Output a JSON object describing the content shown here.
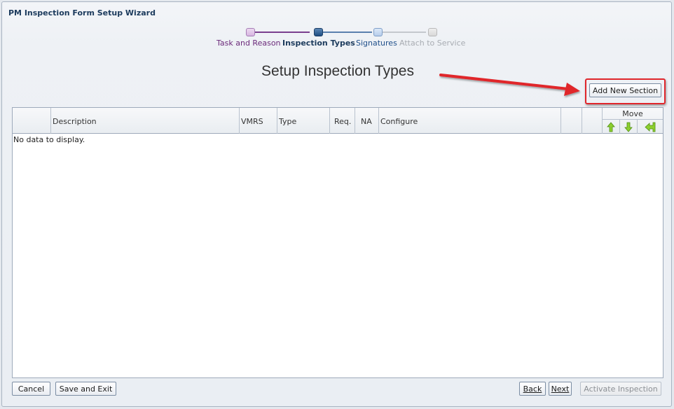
{
  "wizard": {
    "title": "PM Inspection Form Setup Wizard"
  },
  "train": {
    "steps": [
      {
        "label": "Task and Reason",
        "state": "visited"
      },
      {
        "label": "Inspection Types",
        "state": "current"
      },
      {
        "label": "Signatures",
        "state": "next"
      },
      {
        "label": "Attach to Service",
        "state": "disabled"
      }
    ]
  },
  "page": {
    "title": "Setup Inspection Types"
  },
  "actions": {
    "add_section": "Add New Section"
  },
  "table": {
    "columns": [
      "Description",
      "VMRS",
      "Type",
      "Req.",
      "NA",
      "Configure"
    ],
    "move": {
      "title": "Move",
      "up_icon": "arrow-up-icon",
      "down_icon": "arrow-down-icon",
      "reorder_icon": "reorder-icon"
    },
    "empty_text": "No data to display."
  },
  "footer": {
    "cancel": "Cancel",
    "save_exit": "Save and Exit",
    "back": "Back",
    "next": "Next",
    "activate": "Activate Inspection"
  },
  "colors": {
    "annotation": "#e0262b",
    "move_icons": "#6fb31b"
  }
}
